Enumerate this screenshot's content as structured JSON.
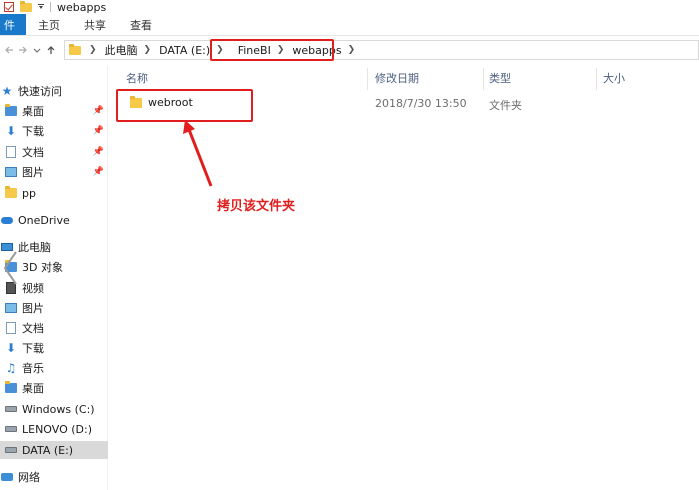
{
  "window": {
    "title": "webapps"
  },
  "ribbon": {
    "tabs": [
      {
        "label": "件"
      },
      {
        "label": "主页"
      },
      {
        "label": "共享"
      },
      {
        "label": "查看"
      }
    ]
  },
  "address": {
    "crumbs": [
      "此电脑",
      "DATA (E:)",
      "FineBI",
      "webapps"
    ]
  },
  "sidebar": {
    "items": [
      {
        "label": "快速访问",
        "icon": "star-icon"
      },
      {
        "label": "桌面",
        "icon": "folder-icon",
        "pinned": true
      },
      {
        "label": "下载",
        "icon": "download-icon",
        "pinned": true
      },
      {
        "label": "文档",
        "icon": "document-icon",
        "pinned": true
      },
      {
        "label": "图片",
        "icon": "picture-icon",
        "pinned": true
      },
      {
        "label": "pp",
        "icon": "folder-icon"
      },
      {
        "label": "OneDrive",
        "icon": "cloud-icon"
      },
      {
        "label": "此电脑",
        "icon": "computer-icon"
      },
      {
        "label": "3D 对象",
        "icon": "folder-icon"
      },
      {
        "label": "视频",
        "icon": "film-icon"
      },
      {
        "label": "图片",
        "icon": "picture-icon"
      },
      {
        "label": "文档",
        "icon": "document-icon"
      },
      {
        "label": "下载",
        "icon": "download-icon"
      },
      {
        "label": "音乐",
        "icon": "music-icon"
      },
      {
        "label": "桌面",
        "icon": "folder-icon"
      },
      {
        "label": "Windows (C:)",
        "icon": "drive-icon"
      },
      {
        "label": "LENOVO (D:)",
        "icon": "drive-icon"
      },
      {
        "label": "DATA (E:)",
        "icon": "drive-icon",
        "selected": true
      },
      {
        "label": "网络",
        "icon": "network-icon"
      }
    ]
  },
  "columns": {
    "name": "名称",
    "date": "修改日期",
    "type": "类型",
    "size": "大小"
  },
  "files": [
    {
      "name": "webroot",
      "date": "2018/7/30 13:50",
      "type": "文件夹",
      "size": ""
    }
  ],
  "annotation": {
    "text": "拷贝该文件夹"
  },
  "colors": {
    "accent": "#1979ca",
    "highlight": "#e01e1e",
    "folder": "#f7c948"
  }
}
